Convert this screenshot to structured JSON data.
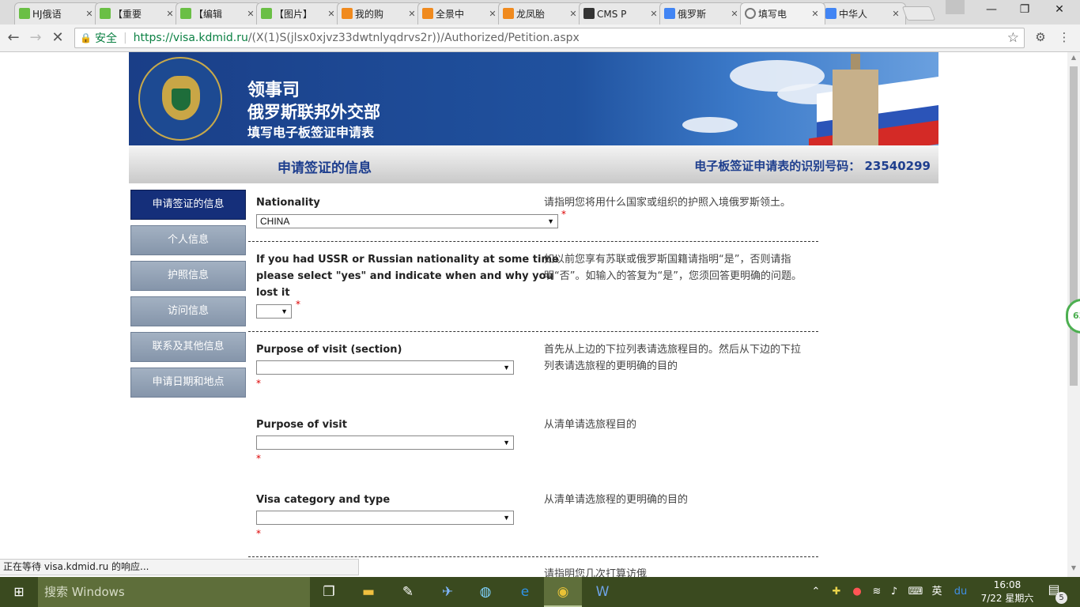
{
  "browser": {
    "tabs": [
      {
        "title": "HJ俄语",
        "color": "#6abf45"
      },
      {
        "title": "【重要",
        "color": "#6abf45"
      },
      {
        "title": "【编辑",
        "color": "#6abf45"
      },
      {
        "title": "【图片】",
        "color": "#6abf45"
      },
      {
        "title": "我的购",
        "color": "#f08a1e"
      },
      {
        "title": "全景中",
        "color": "#f08a1e"
      },
      {
        "title": "龙凤胎",
        "color": "#f08a1e"
      },
      {
        "title": "CMS P",
        "color": "#333333"
      },
      {
        "title": "俄罗斯",
        "color": "#4285f4"
      },
      {
        "title": "填写电",
        "color": "#999999"
      },
      {
        "title": "中华人",
        "color": "#4285f4"
      }
    ],
    "tab_close": "✕",
    "window": {
      "minimize": "—",
      "restore": "❐",
      "close": "✕"
    },
    "address": {
      "secure_label": "安全",
      "url_host": "https://visa.kdmid.ru",
      "url_path": "/(X(1)S(jlsx0xjvz33dwtnlyqdrvs2r))/Authorized/Petition.aspx"
    },
    "status_text": "正在等待 visa.kdmid.ru 的响应..."
  },
  "banner": {
    "line1": "领事司",
    "line2": "俄罗斯联邦外交部",
    "line3": "填写电子板签证申请表"
  },
  "infoband": {
    "title": "申请签证的信息",
    "ident": "电子板签证申请表的识别号码： 23540299"
  },
  "menu": {
    "items": [
      {
        "label": "申请签证的信息"
      },
      {
        "label": "个人信息"
      },
      {
        "label": "护照信息"
      },
      {
        "label": "访问信息"
      },
      {
        "label": "联系及其他信息"
      },
      {
        "label": "申请日期和地点"
      }
    ]
  },
  "form": {
    "nationality": {
      "label": "Nationality",
      "value": "CHINA",
      "help": "请指明您将用什么国家或组织的护照入境俄罗斯领土。"
    },
    "ussr": {
      "label_lines": [
        "If you had USSR or Russian nationality at some time",
        "please select \"yes\" and indicate when and why you",
        "lost it"
      ],
      "value": "",
      "help_lines": [
        "如以前您享有苏联或俄罗斯国籍请指明“是”，否则请指",
        "明“否”。如输入的答复为“是”，您须回答更明确的问题。"
      ]
    },
    "purpose_section": {
      "label": "Purpose of visit (section)",
      "value": "",
      "help_lines": [
        "首先从上边的下拉列表请选旅程目的。然后从下边的下拉",
        "列表请选旅程的更明确的目的"
      ]
    },
    "purpose": {
      "label": "Purpose of visit",
      "value": "",
      "help": "从清单请选旅程目的"
    },
    "visa_category": {
      "label": "Visa category and type",
      "value": "",
      "help": "从清单请选旅程的更明确的目的"
    },
    "next_help_partial": "请指明您几次打算访俄",
    "required_mark": "*"
  },
  "side_badge": "63",
  "taskbar": {
    "search_placeholder": "搜索 Windows",
    "ime": "英",
    "time": "16:08",
    "date": "7/22 星期六",
    "notification_count": "5"
  }
}
